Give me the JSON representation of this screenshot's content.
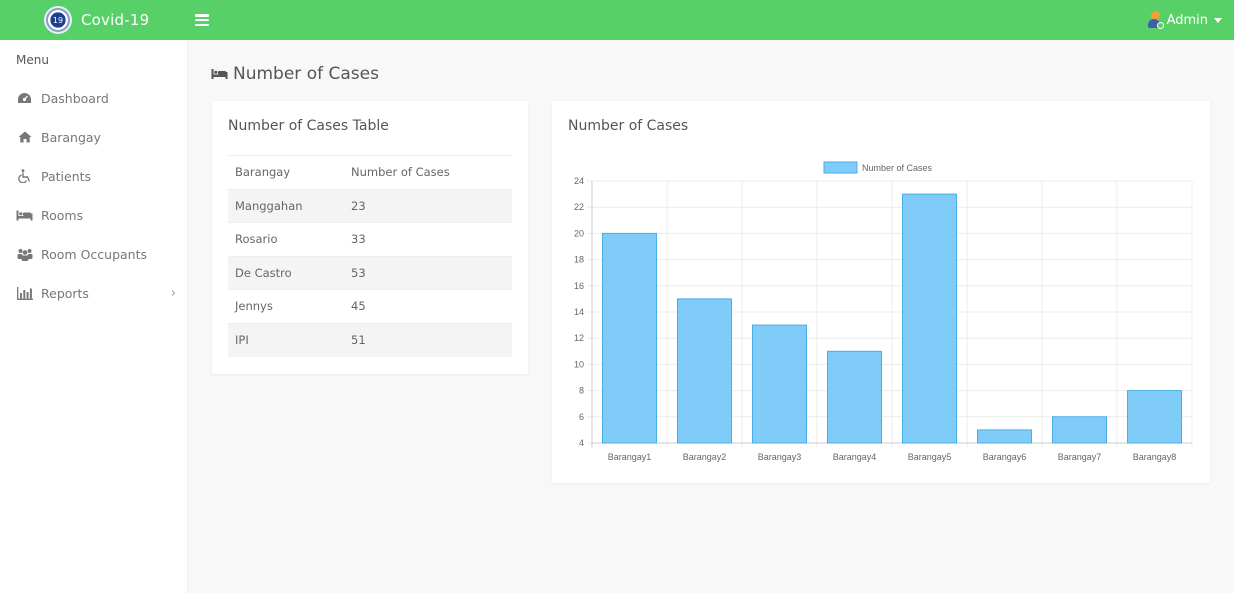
{
  "app": {
    "title": "Covid-19",
    "logo_text": "19"
  },
  "topbar": {
    "user_name": "Admin"
  },
  "sidebar": {
    "menu_title": "Menu",
    "items": [
      {
        "label": "Dashboard",
        "icon": "dashboard-icon",
        "glyph": "◔"
      },
      {
        "label": "Barangay",
        "icon": "home-icon",
        "glyph": "⌂"
      },
      {
        "label": "Patients",
        "icon": "wheelchair-icon",
        "glyph": "♿"
      },
      {
        "label": "Rooms",
        "icon": "bed-icon",
        "glyph": "🛏"
      },
      {
        "label": "Room Occupants",
        "icon": "users-icon",
        "glyph": "👥"
      },
      {
        "label": "Reports",
        "icon": "bar-chart-icon",
        "glyph": "📊",
        "has_submenu": true
      }
    ],
    "chevron": "›"
  },
  "page": {
    "title": "Number of Cases"
  },
  "table_card": {
    "title": "Number of Cases Table",
    "columns": [
      "Barangay",
      "Number of Cases"
    ],
    "rows": [
      [
        "Manggahan",
        "23"
      ],
      [
        "Rosario",
        "33"
      ],
      [
        "De Castro",
        "53"
      ],
      [
        "Jennys",
        "45"
      ],
      [
        "IPI",
        "51"
      ]
    ]
  },
  "chart_card": {
    "title": "Number of Cases"
  },
  "chart_data": {
    "type": "bar",
    "title": "",
    "categories": [
      "Barangay1",
      "Barangay2",
      "Barangay3",
      "Barangay4",
      "Barangay5",
      "Barangay6",
      "Barangay7",
      "Barangay8"
    ],
    "series": [
      {
        "name": "Number of Cases",
        "values": [
          20,
          15,
          13,
          11,
          23,
          5,
          6,
          8
        ]
      }
    ],
    "xlabel": "",
    "ylabel": "",
    "ylim": [
      4,
      24
    ],
    "yticks": [
      4,
      6,
      8,
      10,
      12,
      14,
      16,
      18,
      20,
      22,
      24
    ],
    "grid": true,
    "legend": "top-center",
    "colors": {
      "bar_fill": "#7fccf8",
      "bar_stroke": "#45aee8",
      "grid": "#ececec",
      "axis": "#cccccc"
    }
  }
}
